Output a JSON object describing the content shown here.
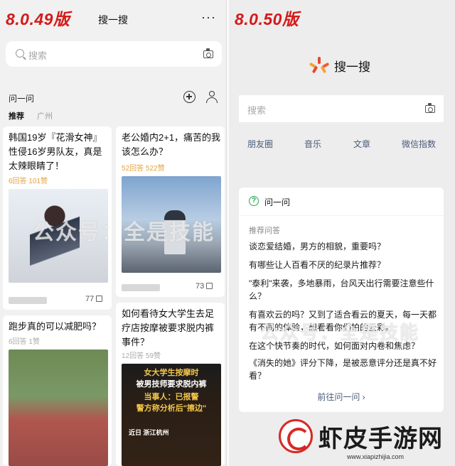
{
  "left": {
    "version": "8.0.49版",
    "title": "搜一搜",
    "more": "···",
    "search_placeholder": "搜索",
    "ask_heading": "问一问",
    "tabs": [
      "推荐",
      "广州"
    ],
    "cards": [
      {
        "question": "韩国19岁『花滑女神』性侵16岁男队友，真是太辣眼睛了！",
        "meta": "6回答 101赞",
        "meta_color": "#e5a13b",
        "likes": "77"
      },
      {
        "question": "老公婚内2+1，痛苦的我该怎么办？",
        "meta": "52回答 522赞",
        "meta_color": "#e5a13b",
        "likes": "73"
      },
      {
        "question": "跑步真的可以减肥吗？",
        "meta": "6回答 1赞",
        "meta_color": "#aaaaaa"
      },
      {
        "question": "如何看待女大学生去足疗店按摩被要求脱内裤事件？",
        "meta": "12回答 59赞",
        "meta_color": "#aaaaaa"
      }
    ],
    "poster": {
      "lines": [
        "女大学生按摩时",
        "被男技师要求脱内裤",
        "当事人：已报警",
        "警方称分析后\"擦边\"",
        "近日 浙江杭州"
      ],
      "colors": [
        "#f3c64a",
        "#ffffff",
        "#f3c64a",
        "#f3c64a",
        "#ffffff"
      ]
    },
    "watermark": "公众号：全是技能"
  },
  "right": {
    "version": "8.0.50版",
    "title": "搜一搜",
    "search_placeholder": "搜索",
    "categories": [
      "朋友圈",
      "音乐",
      "文章",
      "微信指数"
    ],
    "ask_heading": "问一问",
    "recommend_label": "推荐问答",
    "questions": [
      "谈恋爱结婚，男方的相貌，重要吗？",
      "有哪些让人百看不厌的纪录片推荐？",
      "\"泰利\"来袭，多地暴雨，台风天出行需要注意些什么？",
      "有喜欢云的吗？又到了适合看云的夏天，每一天都有不同的体验，想看看你们拍的云彩。",
      "在这个快节奏的时代，如何面对内卷和焦虑？",
      "《消失的她》评分下降，是被恶意评分还是真不好看？"
    ],
    "more_link": "前往问一问 ›",
    "watermark": "公众号：全是技能"
  },
  "brand": {
    "name": "虾皮手游网",
    "url": "www.xiapizhijia.com"
  },
  "colors": {
    "version_red": "#d51a1a",
    "link_blue": "#4a5b7a",
    "accent_green": "#2aa84a"
  }
}
